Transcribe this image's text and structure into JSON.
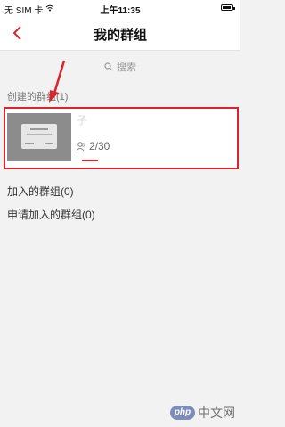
{
  "status_bar": {
    "carrier": "无 SIM 卡",
    "time": "上午11:35"
  },
  "nav": {
    "title": "我的群组"
  },
  "search": {
    "placeholder": "搜索"
  },
  "sections": {
    "created_label": "创建的群组(1)",
    "joined_label": "加入的群组(0)",
    "applied_label": "申请加入的群组(0)"
  },
  "created_groups": [
    {
      "member_count": "2/30"
    }
  ],
  "colors": {
    "accent_red": "#d9232d",
    "background": "#f2f2f2"
  },
  "watermark": {
    "logo": "php",
    "text": "中文网"
  }
}
